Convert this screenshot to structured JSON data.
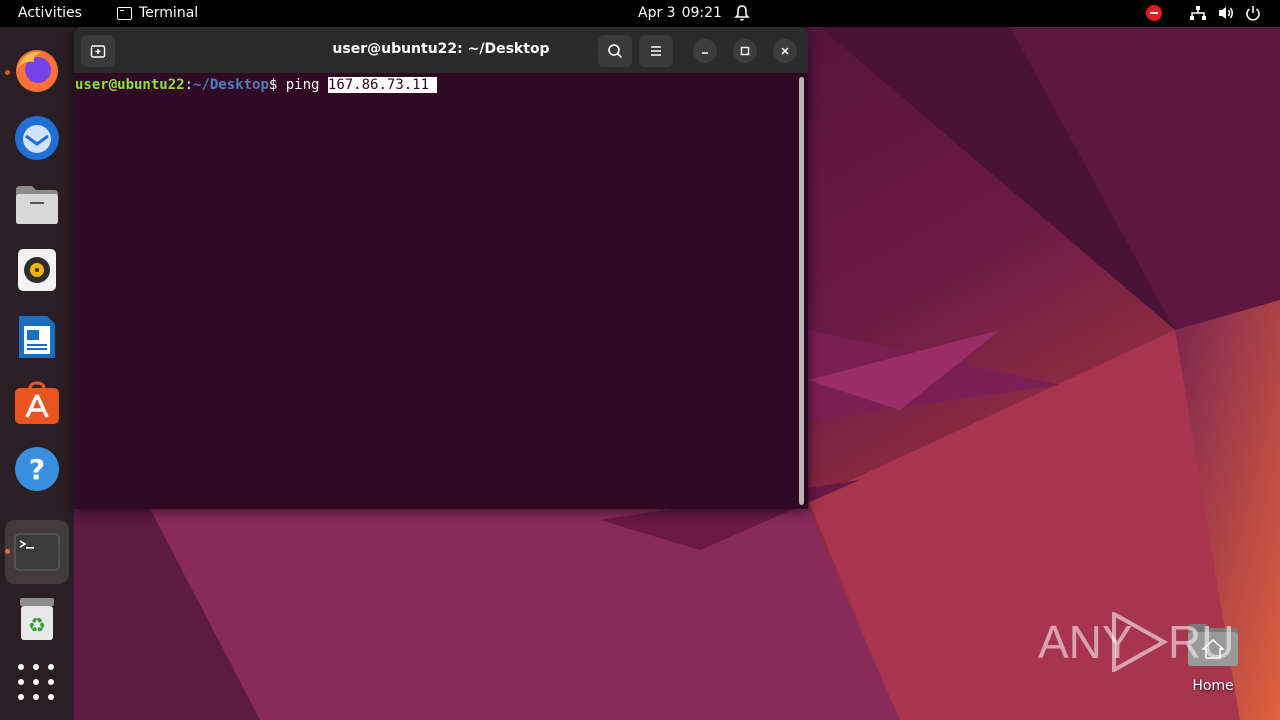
{
  "topbar": {
    "activities": "Activities",
    "app_name": "Terminal",
    "date": "Apr 3",
    "time": "09:21"
  },
  "dock": {
    "items": [
      {
        "name": "firefox",
        "running": true
      },
      {
        "name": "thunderbird",
        "running": false
      },
      {
        "name": "files",
        "running": false
      },
      {
        "name": "rhythmbox",
        "running": false
      },
      {
        "name": "libreoffice-writer",
        "running": false
      },
      {
        "name": "app-center",
        "running": false
      },
      {
        "name": "help",
        "running": false
      },
      {
        "name": "terminal",
        "running": true
      },
      {
        "name": "trash",
        "running": false
      }
    ]
  },
  "terminal": {
    "title": "user@ubuntu22: ~/Desktop",
    "prompt_user": "user@ubuntu22",
    "prompt_sep": ":",
    "prompt_path": "~/Desktop",
    "prompt_symbol": "$ ",
    "command": "ping ",
    "selected_text": "167.86.73.11 "
  },
  "desktop": {
    "home_label": "Home"
  },
  "watermark": {
    "text": "ANY RUN"
  },
  "colors": {
    "accent": "#e95420",
    "terminal_bg": "#300a24",
    "prompt_user": "#8ae234",
    "prompt_path": "#4e7fc1"
  }
}
